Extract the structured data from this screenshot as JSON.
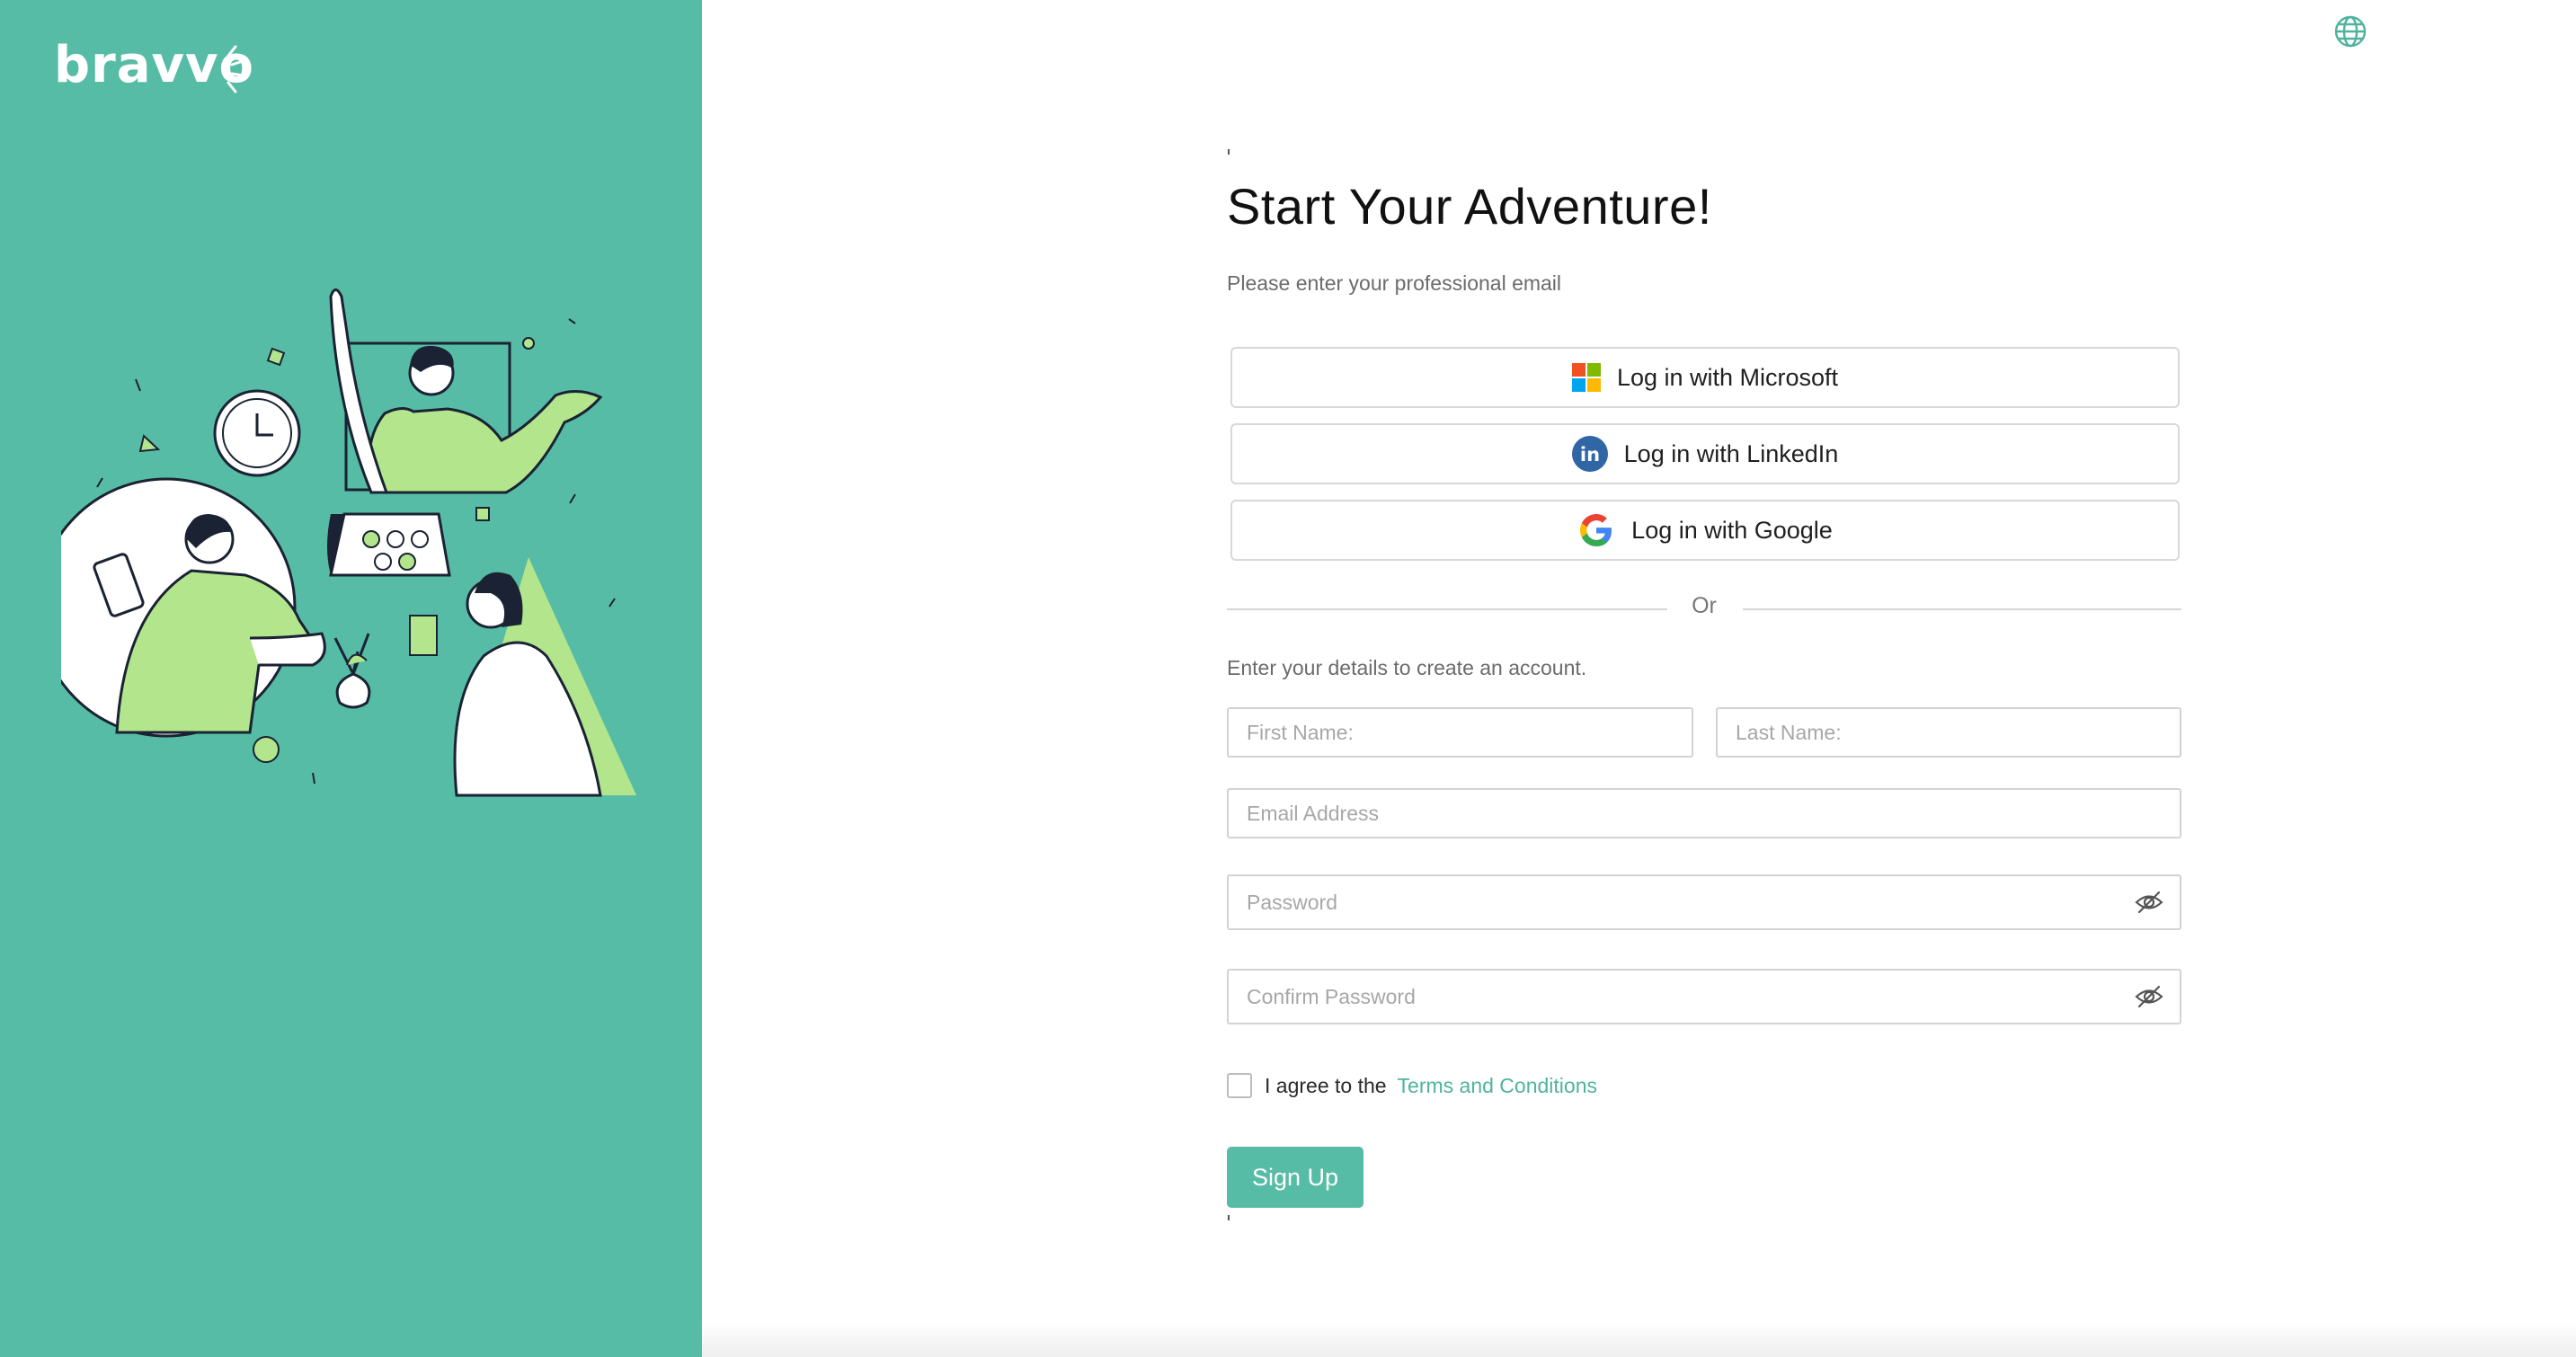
{
  "brand": {
    "logo_text": "bravvo",
    "primary_color": "#57bca6",
    "link_color": "#4fb39e"
  },
  "header": {
    "language_icon": "globe-icon"
  },
  "form": {
    "title": "Start Your Adventure!",
    "subtitle": "Please enter your professional email",
    "sso": {
      "microsoft_label": "Log in with Microsoft",
      "linkedin_label": "Log in with LinkedIn",
      "google_label": "Log in with Google"
    },
    "divider_text": "Or",
    "details_text": "Enter your details to create an account.",
    "fields": {
      "first_name_placeholder": "First Name:",
      "last_name_placeholder": "Last Name:",
      "email_placeholder": "Email Address",
      "password_placeholder": "Password",
      "confirm_password_placeholder": "Confirm Password"
    },
    "agree_text": "I agree to the",
    "terms_link": "Terms and Conditions",
    "terms_checked": false,
    "submit_label": "Sign Up"
  },
  "icons": {
    "password_toggle": "eye-slash-icon",
    "microsoft": "microsoft-icon",
    "linkedin": "linkedin-icon",
    "google": "google-icon"
  }
}
